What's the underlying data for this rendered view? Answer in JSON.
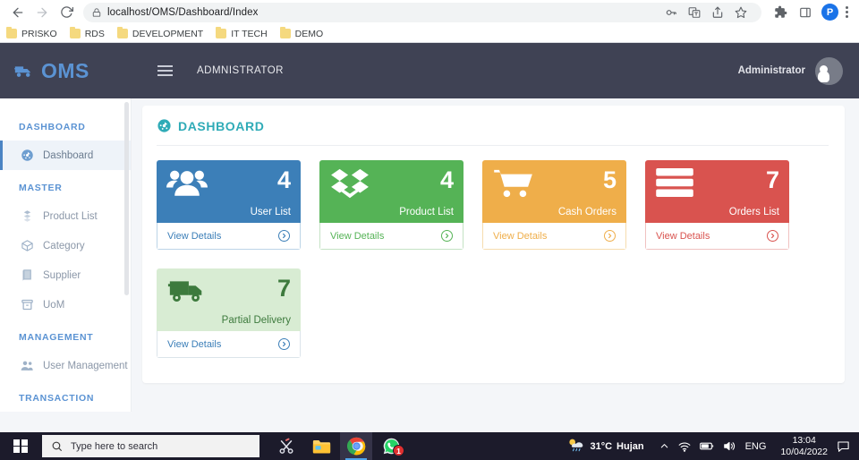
{
  "browser": {
    "url": "localhost/OMS/Dashboard/Index",
    "back_icon": "back-arrow-icon",
    "forward_icon": "forward-arrow-icon",
    "reload_icon": "reload-icon",
    "lock_icon": "lock-icon",
    "omnibox_actions": [
      "password-key-icon",
      "translate-icon",
      "share-icon",
      "bookmark-star-icon"
    ],
    "extensions_icon": "extensions-puzzle-icon",
    "sidepanel_icon": "side-panel-icon",
    "profile_initial": "P",
    "menu_icon": "three-dot-menu-icon",
    "bookmarks": [
      {
        "label": "PRISKO"
      },
      {
        "label": "RDS"
      },
      {
        "label": "DEVELOPMENT"
      },
      {
        "label": "IT TECH"
      },
      {
        "label": "DEMO"
      }
    ]
  },
  "app_header": {
    "brand": "OMS",
    "brand_icon": "truck-icon",
    "menu_toggle_icon": "hamburger-menu-icon",
    "title": "ADMNISTRATOR",
    "user_name": "Administrator",
    "avatar_icon": "user-avatar-icon",
    "bg_color": "#3f4254",
    "brand_color": "#5b93d3"
  },
  "sidebar": {
    "groups": [
      {
        "heading": "DASHBOARD",
        "items": [
          {
            "label": "Dashboard",
            "icon": "dashboard-gauge-icon",
            "active": true
          }
        ]
      },
      {
        "heading": "MASTER",
        "items": [
          {
            "label": "Product List",
            "icon": "boxes-icon",
            "active": false
          },
          {
            "label": "Category",
            "icon": "cube-icon",
            "active": false
          },
          {
            "label": "Supplier",
            "icon": "book-icon",
            "active": false
          },
          {
            "label": "UoM",
            "icon": "archive-box-icon",
            "active": false
          }
        ]
      },
      {
        "heading": "MANAGEMENT",
        "items": [
          {
            "label": "User Management",
            "icon": "users-icon",
            "active": false
          }
        ]
      },
      {
        "heading": "TRANSACTION",
        "items": []
      }
    ],
    "heading_color": "#5b93d3"
  },
  "panel": {
    "title": "DASHBOARD",
    "title_icon": "dashboard-gauge-icon",
    "title_color": "#2fabb7",
    "cards": [
      {
        "value": "4",
        "label": "User List",
        "footer": "View Details",
        "icon": "users-group-icon",
        "color": "#3c7fb8",
        "footer_color": "#3c7fb8",
        "light": false
      },
      {
        "value": "4",
        "label": "Product List",
        "footer": "View Details",
        "icon": "dropbox-boxes-icon",
        "color": "#55b356",
        "footer_color": "#55b356",
        "light": false
      },
      {
        "value": "5",
        "label": "Cash Orders",
        "footer": "View Details",
        "icon": "shopping-cart-icon",
        "color": "#efae4a",
        "footer_color": "#efae4a",
        "light": false
      },
      {
        "value": "7",
        "label": "Orders List",
        "footer": "View Details",
        "icon": "server-rack-icon",
        "color": "#d9534f",
        "footer_color": "#d9534f",
        "light": false
      },
      {
        "value": "7",
        "label": "Partial Delivery",
        "footer": "View Details",
        "icon": "delivery-truck-icon",
        "color": "#d8ecd3",
        "footer_color": "#3c7fb8",
        "light": true
      }
    ]
  },
  "taskbar": {
    "start_icon": "windows-start-icon",
    "search_placeholder": "Type here to search",
    "search_icon": "search-magnifier-icon",
    "apps": [
      {
        "name": "snipping-tool-icon",
        "badge": ""
      },
      {
        "name": "file-explorer-icon",
        "badge": ""
      },
      {
        "name": "chrome-icon",
        "badge": ""
      },
      {
        "name": "whatsapp-icon",
        "badge": "1"
      }
    ],
    "weather_temp": "31°C",
    "weather_desc": "Hujan",
    "weather_icon": "partly-cloudy-rain-icon",
    "tray_icons": [
      "show-hidden-chevron-icon",
      "wifi-icon",
      "battery-icon",
      "volume-icon"
    ],
    "language": "ENG",
    "time": "13:04",
    "date": "10/04/2022",
    "notification_icon": "notification-chat-icon"
  }
}
